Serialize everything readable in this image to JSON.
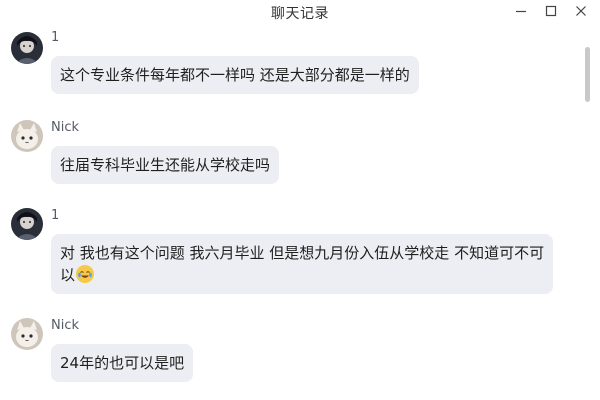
{
  "window": {
    "title": "聊天记录",
    "controls": [
      "minimize-icon",
      "maximize-icon",
      "close-icon"
    ]
  },
  "messages": [
    {
      "sender": "1",
      "avatar": "dark-anime-avatar",
      "text": "这个专业条件每年都不一样吗 还是大部分都是一样的"
    },
    {
      "sender": "Nick",
      "avatar": "cat-avatar",
      "text": "往届专科毕业生还能从学校走吗"
    },
    {
      "sender": "1",
      "avatar": "dark-anime-avatar",
      "line1": "对 我也有这个问题 我六月毕业 但是想九月份入伍从学校走 不知道可不可",
      "line2": "以",
      "emoji": "crying-laughing-emoji"
    },
    {
      "sender": "Nick",
      "avatar": "cat-avatar",
      "text": "24年的也可以是吧"
    }
  ],
  "colors": {
    "bubble_bg": "#eceef3",
    "sender_text": "#555b66",
    "scroll_thumb": "#c9c9c9"
  }
}
